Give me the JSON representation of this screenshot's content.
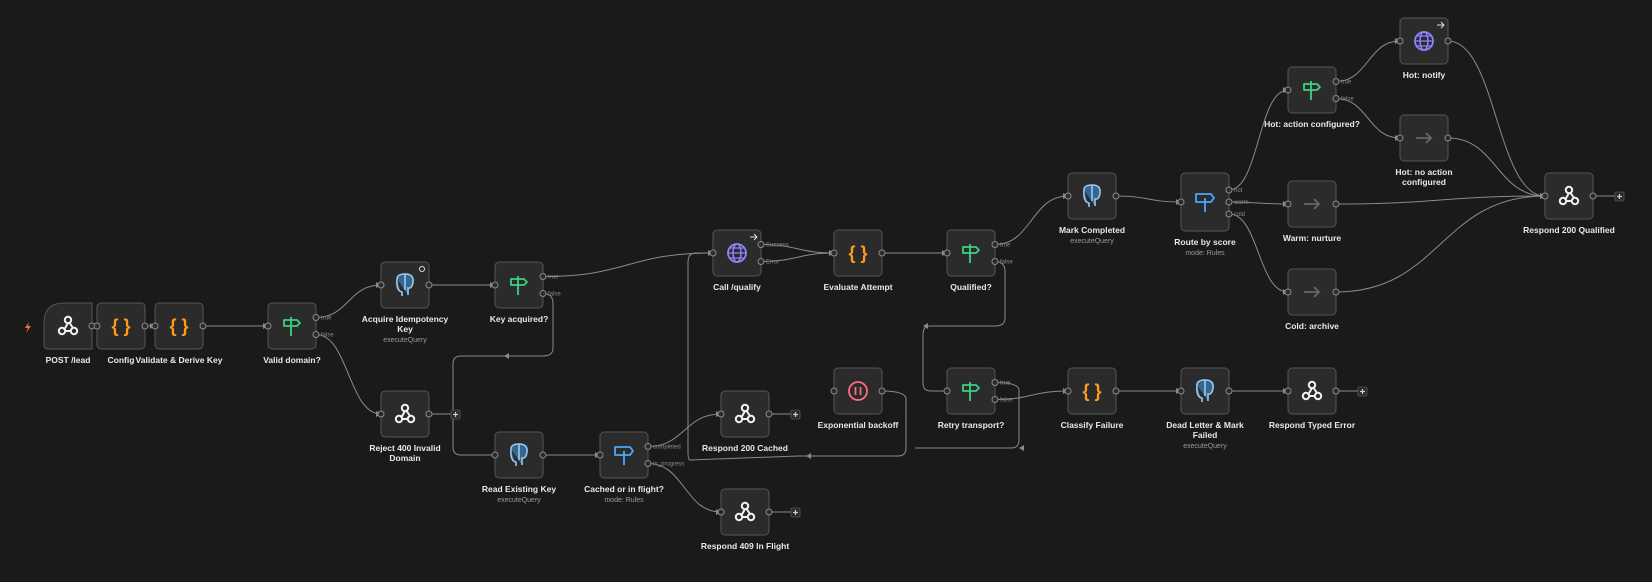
{
  "colors": {
    "background": "#1a1a1a",
    "node_fill": "#2b2b2b",
    "node_border": "#555555",
    "edge": "#8a8a8a",
    "trigger": "#ff6d3a",
    "code": "#ff9b1a",
    "if": "#3ed082",
    "switch": "#4aa8ff",
    "http": "#8f84ff",
    "wait": "#ff6b87",
    "noop": "#666666"
  },
  "nodes": [
    {
      "id": "post",
      "label": "POST /lead",
      "sub": "",
      "icon": "webhook-icon",
      "trigger": true
    },
    {
      "id": "config",
      "label": "Config",
      "sub": "",
      "icon": "code-icon"
    },
    {
      "id": "validate",
      "label": "Validate & Derive Key",
      "sub": "",
      "icon": "code-icon"
    },
    {
      "id": "validdomain",
      "label": "Valid domain?",
      "sub": "",
      "icon": "if-icon",
      "outputs": [
        "true",
        "false"
      ]
    },
    {
      "id": "acquire",
      "label": "Acquire Idempotency Key",
      "sub": "executeQuery",
      "icon": "postgres-icon"
    },
    {
      "id": "reject400",
      "label": "Reject 400 Invalid Domain",
      "sub": "",
      "icon": "webhook-icon"
    },
    {
      "id": "keyacq",
      "label": "Key acquired?",
      "sub": "",
      "icon": "if-icon",
      "outputs": [
        "true",
        "false"
      ]
    },
    {
      "id": "readkey",
      "label": "Read Existing Key",
      "sub": "executeQuery",
      "icon": "postgres-icon"
    },
    {
      "id": "cached",
      "label": "Cached or in flight?",
      "sub": "mode: Rules",
      "icon": "switch-icon",
      "outputs": [
        "completed",
        "in_progress"
      ]
    },
    {
      "id": "call",
      "label": "Call /qualify",
      "sub": "",
      "icon": "globe-icon",
      "outputs": [
        "Success",
        "Error"
      ]
    },
    {
      "id": "r200c",
      "label": "Respond 200 Cached",
      "sub": "",
      "icon": "webhook-icon"
    },
    {
      "id": "r409",
      "label": "Respond 409 In Flight",
      "sub": "",
      "icon": "webhook-icon"
    },
    {
      "id": "eval",
      "label": "Evaluate Attempt",
      "sub": "",
      "icon": "code-icon"
    },
    {
      "id": "backoff",
      "label": "Exponential backoff",
      "sub": "",
      "icon": "pause-icon"
    },
    {
      "id": "qualified",
      "label": "Qualified?",
      "sub": "",
      "icon": "if-icon",
      "outputs": [
        "true",
        "false"
      ]
    },
    {
      "id": "retry",
      "label": "Retry transport?",
      "sub": "",
      "icon": "if-icon",
      "outputs": [
        "true",
        "false"
      ]
    },
    {
      "id": "markc",
      "label": "Mark Completed",
      "sub": "executeQuery",
      "icon": "postgres-icon"
    },
    {
      "id": "classify",
      "label": "Classify Failure",
      "sub": "",
      "icon": "code-icon"
    },
    {
      "id": "route",
      "label": "Route by score",
      "sub": "mode: Rules",
      "icon": "switch-icon",
      "outputs": [
        "hot",
        "warm",
        "cold"
      ]
    },
    {
      "id": "deadletter",
      "label": "Dead Letter & Mark Failed",
      "sub": "executeQuery",
      "icon": "postgres-icon"
    },
    {
      "id": "hotact",
      "label": "Hot: action configured?",
      "sub": "",
      "icon": "if-icon",
      "outputs": [
        "true",
        "false"
      ]
    },
    {
      "id": "warm",
      "label": "Warm: nurture",
      "sub": "",
      "icon": "arrow-right-icon"
    },
    {
      "id": "cold",
      "label": "Cold: archive",
      "sub": "",
      "icon": "arrow-right-icon"
    },
    {
      "id": "rte",
      "label": "Respond Typed Error",
      "sub": "",
      "icon": "webhook-icon"
    },
    {
      "id": "hotnotify",
      "label": "Hot: notify",
      "sub": "",
      "icon": "globe-icon"
    },
    {
      "id": "hotnoaction",
      "label": "Hot: no action configured",
      "sub": "",
      "icon": "arrow-right-icon"
    },
    {
      "id": "r200q",
      "label": "Respond 200 Qualified",
      "sub": "",
      "icon": "webhook-icon"
    }
  ]
}
